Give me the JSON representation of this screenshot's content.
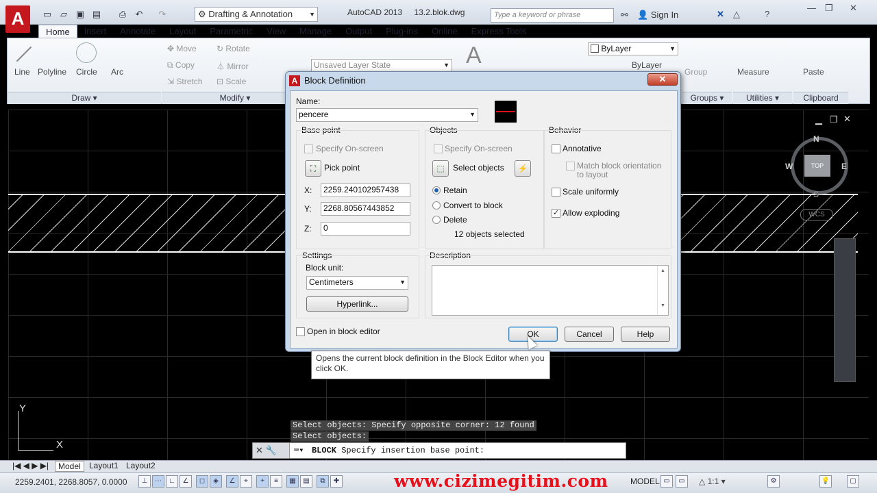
{
  "titlebar": {
    "logo": "A",
    "workspace": "Drafting & Annotation",
    "app_name": "AutoCAD 2013",
    "file_name": "13.2.blok.dwg",
    "search_placeholder": "Type a keyword or phrase",
    "sign_in": "Sign In"
  },
  "ribbon": {
    "tabs": [
      "Home",
      "Insert",
      "Annotate",
      "Layout",
      "Parametric",
      "View",
      "Manage",
      "Output",
      "Plug-ins",
      "Online",
      "Express Tools"
    ],
    "draw_tools": [
      "Line",
      "Polyline",
      "Circle",
      "Arc"
    ],
    "modify_tools": [
      "Move",
      "Rotate",
      "Copy",
      "Mirror",
      "Stretch",
      "Scale"
    ],
    "layer_state": "Unsaved Layer State",
    "bylayer_color": "ByLayer",
    "bylayer_line": "ByLayer",
    "group": "Group",
    "measure": "Measure",
    "paste": "Paste",
    "panels": {
      "draw": "Draw",
      "modify": "Modify",
      "groups": "Groups",
      "utilities": "Utilities",
      "clipboard": "Clipboard"
    }
  },
  "viewcube": {
    "top": "TOP",
    "n": "N",
    "s": "S",
    "e": "E",
    "w": "W",
    "wcs": "WCS"
  },
  "ucs": {
    "x": "X",
    "y": "Y"
  },
  "dialog": {
    "title": "Block Definition",
    "name_label": "Name:",
    "name_value": "pencere",
    "base_point": {
      "title": "Base point",
      "specify_on_screen": "Specify On-screen",
      "pick_point": "Pick point",
      "x_label": "X:",
      "x_value": "2259.240102957438",
      "y_label": "Y:",
      "y_value": "2268.80567443852",
      "z_label": "Z:",
      "z_value": "0"
    },
    "objects": {
      "title": "Objects",
      "specify_on_screen": "Specify On-screen",
      "select_objects": "Select objects",
      "retain": "Retain",
      "convert": "Convert to block",
      "delete": "Delete",
      "count": "12 objects selected"
    },
    "behavior": {
      "title": "Behavior",
      "annotative": "Annotative",
      "match_orientation_1": "Match block orientation",
      "match_orientation_2": "to layout",
      "scale_uniformly": "Scale uniformly",
      "allow_exploding": "Allow exploding"
    },
    "settings": {
      "title": "Settings",
      "block_unit_label": "Block unit:",
      "block_unit": "Centimeters",
      "hyperlink": "Hyperlink..."
    },
    "description": {
      "title": "Description"
    },
    "open_in_editor": "Open in block editor",
    "ok": "OK",
    "cancel": "Cancel",
    "help": "Help",
    "tooltip": "Opens the current block definition in the Block Editor when you click OK."
  },
  "command": {
    "history1": "Select objects: Specify opposite corner: 12 found",
    "history2": "Select objects:",
    "prompt_cmd": "BLOCK",
    "prompt_text": "Specify insertion base point:"
  },
  "layout_tabs": [
    "Model",
    "Layout1",
    "Layout2"
  ],
  "status": {
    "coords": "2259.2401, 2268.8057, 0.0000",
    "watermark": "www.cizimegitim.com",
    "space": "MODEL",
    "scale": "1:1"
  }
}
